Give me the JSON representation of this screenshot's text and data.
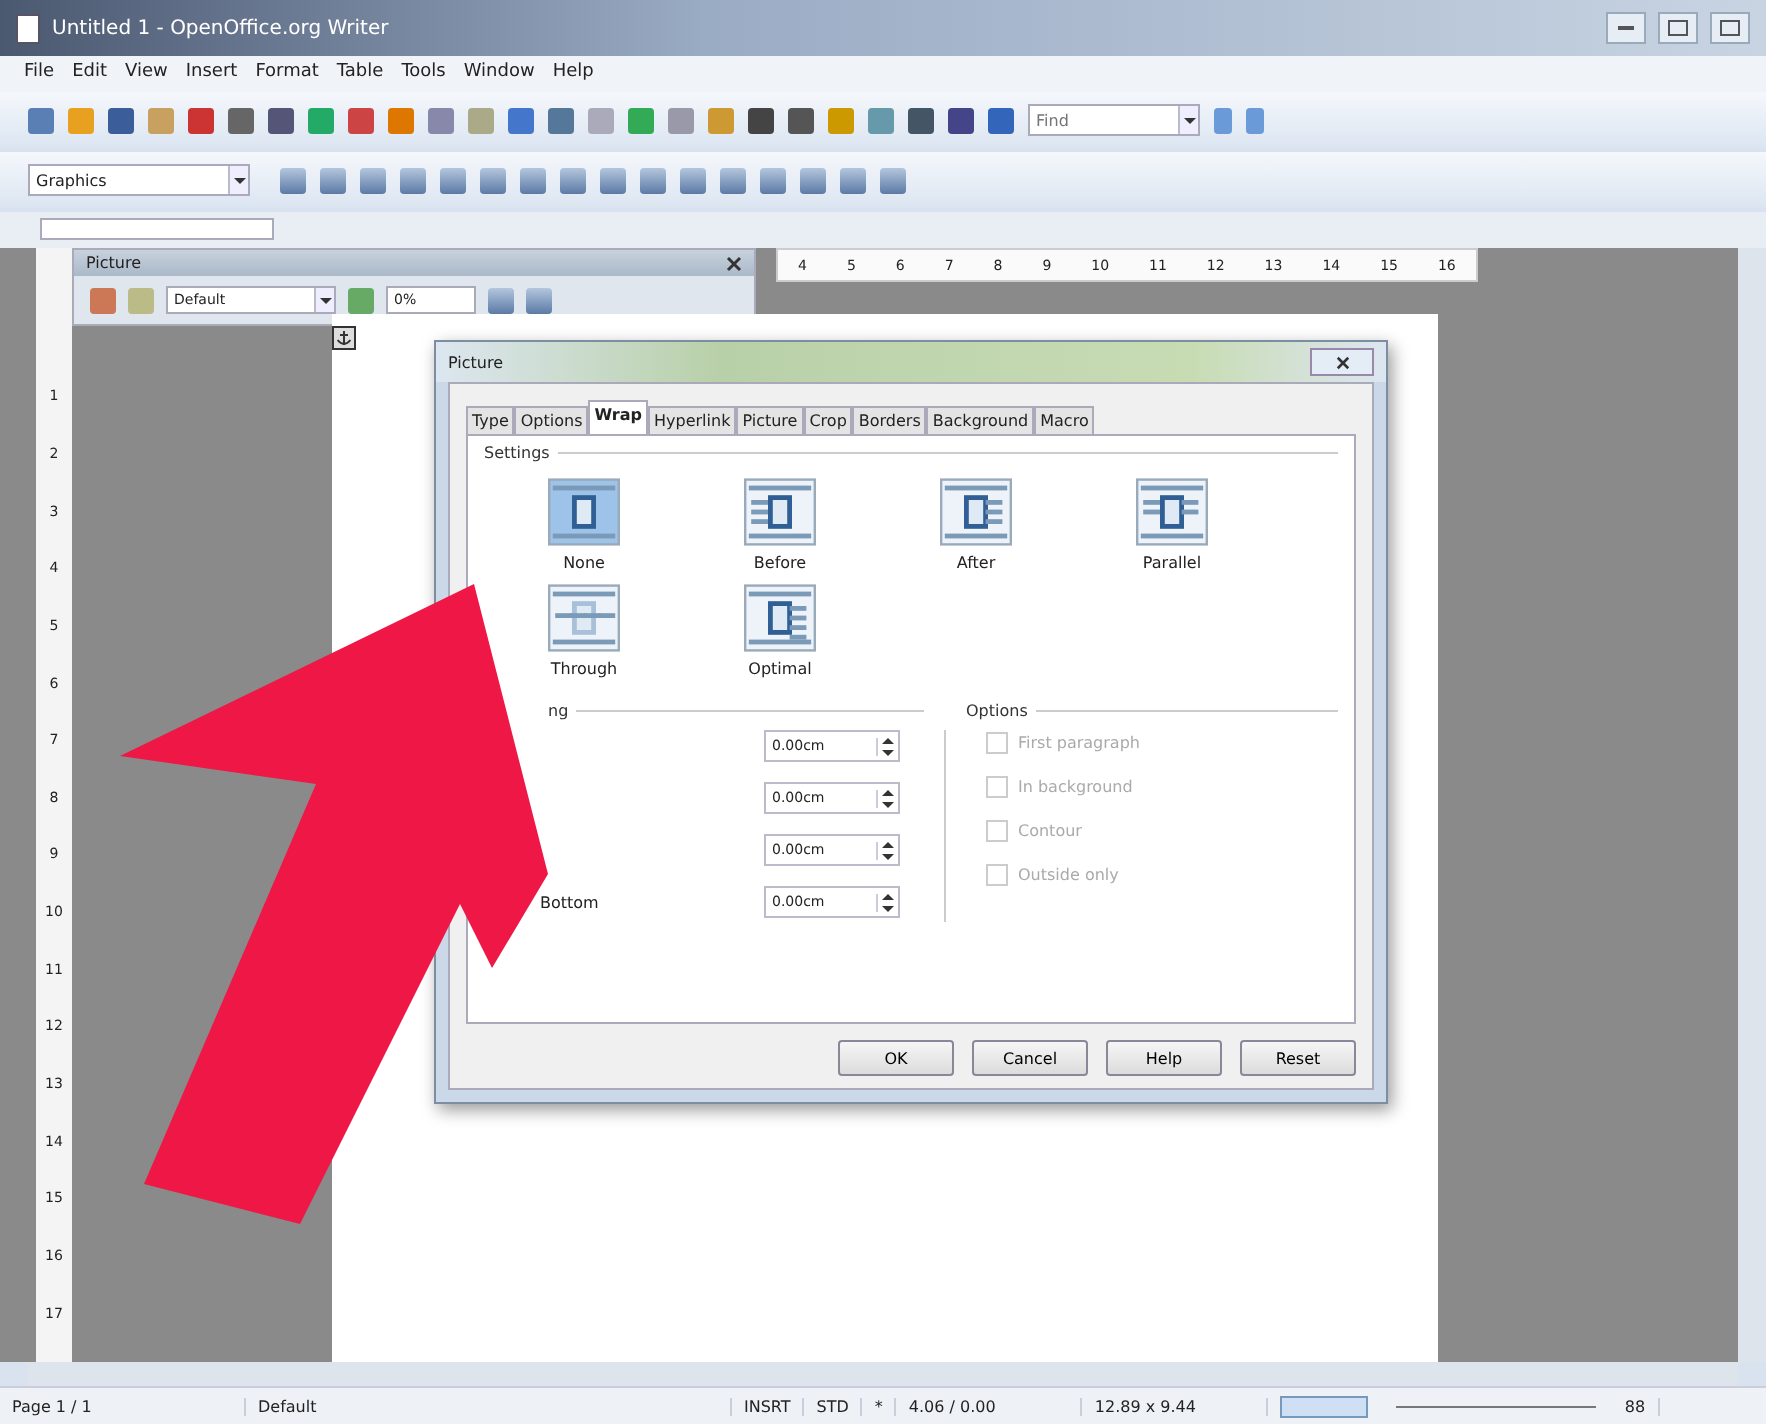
{
  "window": {
    "title": "Untitled 1 - OpenOffice.org Writer"
  },
  "menu": [
    "File",
    "Edit",
    "View",
    "Insert",
    "Format",
    "Table",
    "Tools",
    "Window",
    "Help"
  ],
  "toolbar": {
    "find": {
      "placeholder": "Find"
    },
    "style": "Graphics"
  },
  "picture_toolbar": {
    "title": "Picture",
    "filter": "Default",
    "transparency": "0%"
  },
  "horizontal_ruler": [
    "4",
    "5",
    "6",
    "7",
    "8",
    "9",
    "10",
    "11",
    "12",
    "13",
    "14",
    "15",
    "16"
  ],
  "vertical_ruler": [
    "1",
    "2",
    "3",
    "4",
    "5",
    "6",
    "7",
    "8",
    "9",
    "10",
    "11",
    "12",
    "13",
    "14",
    "15",
    "16",
    "17"
  ],
  "dialog": {
    "title": "Picture",
    "tabs": [
      {
        "label": "Type",
        "selected": false
      },
      {
        "label": "Options",
        "selected": false
      },
      {
        "label": "Wrap",
        "selected": true
      },
      {
        "label": "Hyperlink",
        "selected": false
      },
      {
        "label": "Picture",
        "selected": false
      },
      {
        "label": "Crop",
        "selected": false
      },
      {
        "label": "Borders",
        "selected": false
      },
      {
        "label": "Background",
        "selected": false
      },
      {
        "label": "Macro",
        "selected": false
      }
    ],
    "settings_title": "Settings",
    "settings": [
      {
        "label": "None",
        "kind": "none",
        "selected": true
      },
      {
        "label": "Before",
        "kind": "before",
        "selected": false
      },
      {
        "label": "After",
        "kind": "after",
        "selected": false
      },
      {
        "label": "Parallel",
        "kind": "parallel",
        "selected": false
      },
      {
        "label": "Through",
        "kind": "through",
        "selected": false
      },
      {
        "label": "Optimal",
        "kind": "optimal",
        "selected": false
      }
    ],
    "spacing_title": "ng",
    "spacing": [
      {
        "value": "0.00cm"
      },
      {
        "value": "0.00cm"
      },
      {
        "value": "0.00cm"
      },
      {
        "label": "Bottom",
        "value": "0.00cm"
      }
    ],
    "options_title": "Options",
    "options": [
      {
        "label": "First paragraph",
        "checked": false,
        "disabled": true
      },
      {
        "label": "In background",
        "checked": false,
        "disabled": true
      },
      {
        "label": "Contour",
        "checked": false,
        "disabled": true
      },
      {
        "label": "Outside only",
        "checked": false,
        "disabled": true
      }
    ],
    "buttons": [
      "OK",
      "Cancel",
      "Help",
      "Reset"
    ]
  },
  "status_bar": {
    "page": "Page 1 / 1",
    "style": "Default",
    "mode": "INSRT",
    "selection": "STD",
    "modified": "*",
    "position": "4.06 / 0.00",
    "size": "12.89 x 9.44",
    "zoom": "88"
  }
}
